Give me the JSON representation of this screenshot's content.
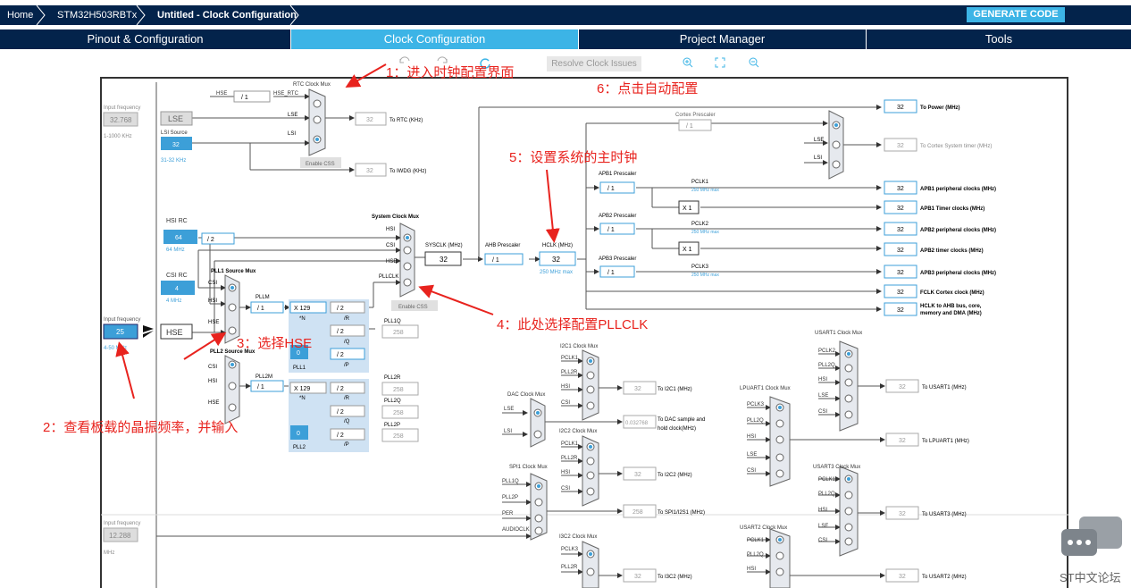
{
  "header": {
    "crumbs": [
      "Home",
      "STM32H503RBTx",
      "Untitled - Clock Configuration"
    ],
    "generate": "GENERATE CODE"
  },
  "tabs": [
    "Pinout & Configuration",
    "Clock Configuration",
    "Project Manager",
    "Tools"
  ],
  "toolbar": {
    "resolve": "Resolve Clock Issues"
  },
  "inputs": {
    "lse_input_label": "Input frequency",
    "lse_freq": "32.768",
    "lse_range": "1-1000 KHz",
    "hse_input_label": "Input frequency",
    "hse_freq": "25",
    "hse_range": "4-50 MHz",
    "audio_input_label": "Input frequency",
    "audio_freq": "12.288",
    "audio_unit": "MHz"
  },
  "sources": {
    "lse": "LSE",
    "lsi_src": "LSI Source",
    "lsi_val": "32",
    "lsi_range": "31-32 KHz",
    "hsi_rc": "HSI RC",
    "hsi_val": "64",
    "hsi_unit": "64 MHz",
    "csi_rc": "CSI RC",
    "csi_val": "4",
    "csi_unit": "4 MHz",
    "hse": "HSE"
  },
  "rtc": {
    "mux_title": "RTC Clock Mux",
    "hse": "HSE",
    "hse_div": "/ 1",
    "hse_rtc": "HSE_RTC",
    "lse": "LSE",
    "lsi": "LSI",
    "out": "32",
    "out_label": "To RTC (KHz)",
    "enable_css": "Enable CSS",
    "iwdg": "32",
    "iwdg_label": "To IWDG (KHz)"
  },
  "pll": {
    "hsi_div": "/ 2",
    "pll1_mux": "PLL1 Source Mux",
    "pll2_mux": "PLL2 Source Mux",
    "csi": "CSI",
    "hsi": "HSI",
    "hse": "HSE",
    "pllm": "PLLM",
    "pllm_val": "/ 1",
    "pll2m": "PLL2M",
    "pll2m_val": "/ 1",
    "mul": "X 129",
    "mul2": "X 129",
    "n": "*N",
    "r": "/ 2",
    "r_lbl": "/R",
    "q": "/ 2",
    "q_lbl": "/Q",
    "p": "/ 2",
    "p_lbl": "/P",
    "pll1": "PLL1",
    "pll2": "PLL2",
    "zero": "0",
    "pll1q": "PLL1Q",
    "pll1q_val": "258",
    "pll2r": "PLL2R",
    "pll2r_val": "258",
    "pll2q": "PLL2Q",
    "pll2q_val": "258",
    "pll2p": "PLL2P",
    "pll2p_val": "258"
  },
  "sys": {
    "mux_title": "System Clock Mux",
    "hsi": "HSI",
    "csi": "CSI",
    "hse": "HSE",
    "pllclk": "PLLCLK",
    "enable_css": "Enable CSS",
    "sysclk_lbl": "SYSCLK (MHz)",
    "sysclk": "32",
    "ahb_lbl": "AHB Prescaler",
    "ahb": "/ 1",
    "hclk_lbl": "HCLK (MHz)",
    "hclk": "32",
    "hclk_max": "250 MHz max"
  },
  "outputs": {
    "power": "32",
    "power_lbl": "To Power (MHz)",
    "cortex_pre_lbl": "Cortex Prescaler",
    "cortex_pre": "/ 1",
    "lse": "LSE",
    "lsi": "LSI",
    "systimer": "32",
    "systimer_lbl": "To Cortex System timer (MHz)",
    "apb1_lbl": "APB1 Prescaler",
    "apb1": "/ 1",
    "pclk1": "PCLK1",
    "pclk1_max": "250 MHz max",
    "apb1_periph": "32",
    "apb1_periph_lbl": "APB1 peripheral clocks (MHz)",
    "x1a": "X 1",
    "apb1_timer": "32",
    "apb1_timer_lbl": "APB1 Timer clocks (MHz)",
    "apb2_lbl": "APB2 Prescaler",
    "apb2": "/ 1",
    "pclk2": "PCLK2",
    "pclk2_max": "250 MHz max",
    "apb2_periph": "32",
    "apb2_periph_lbl": "APB2 peripheral clocks (MHz)",
    "x1b": "X 1",
    "apb2_timer": "32",
    "apb2_timer_lbl": "APB2 timer clocks (MHz)",
    "apb3_lbl": "APB3 Prescaler",
    "apb3": "/ 1",
    "pclk3": "PCLK3",
    "pclk3_max": "250 MHz max",
    "apb3_periph": "32",
    "apb3_periph_lbl": "APB3 peripheral clocks (MHz)",
    "fclk": "32",
    "fclk_lbl": "FCLK Cortex clock (MHz)",
    "ahb_out": "32",
    "ahb_out_lbl1": "HCLK to AHB bus, core,",
    "ahb_out_lbl2": "memory and DMA (MHz)"
  },
  "periph": {
    "i2c1_title": "I2C1 Clock Mux",
    "i2c1": "32",
    "i2c1_lbl": "To I2C1 (MHz)",
    "i2c2_title": "I2C2 Clock Mux",
    "i2c2": "32",
    "i2c2_lbl": "To I2C2 (MHz)",
    "i3c2_title": "I3C2 Clock Mux",
    "i3c2": "32",
    "i3c2_lbl": "To I3C2 (MHz)",
    "dac_title": "DAC Clock Mux",
    "dac": "0.032768",
    "dac_lbl1": "To DAC sample and",
    "dac_lbl2": "hold clock(MHz)",
    "spi1_title": "SPI1 Clock Mux",
    "spi1": "258",
    "spi1_lbl": "To SPI1/I2S1 (MHz)",
    "lpuart_title": "LPUART1 Clock Mux",
    "lpuart": "32",
    "lpuart_lbl": "To LPUART1 (MHz)",
    "usart1_title": "USART1 Clock Mux",
    "usart1": "32",
    "usart1_lbl": "To USART1 (MHz)",
    "usart3_title": "USART3 Clock Mux",
    "usart3": "32",
    "usart3_lbl": "To USART3 (MHz)",
    "usart2_title": "USART2 Clock Mux",
    "usart2": "32",
    "usart2_lbl": "To USART2 (MHz)",
    "pclk1": "PCLK1",
    "pll2r": "PLL2R",
    "hsi": "HSI",
    "csi": "CSI",
    "lse": "LSE",
    "lsi": "LSI",
    "pll1q": "PLL1Q",
    "pll2p": "PLL2P",
    "per": "PER",
    "audioclk": "AUDIOCLK",
    "pclk3": "PCLK3",
    "pll2q": "PLL2Q",
    "pclk2": "PCLK2"
  },
  "annotations": {
    "a1": "1：进入时钟配置界面",
    "a2": "2：查看板载的晶振频率，并输入",
    "a3": "3：选择HSE",
    "a4": "4：此处选择配置PLLCLK",
    "a5": "5：设置系统的主时钟",
    "a6": "6：点击自动配置"
  },
  "watermark": "ST中文论坛",
  "colors": {
    "navy": "#03234b",
    "accent": "#3cb4e6",
    "annotation": "#e8231e",
    "source_fill": "#3c9fd8"
  }
}
